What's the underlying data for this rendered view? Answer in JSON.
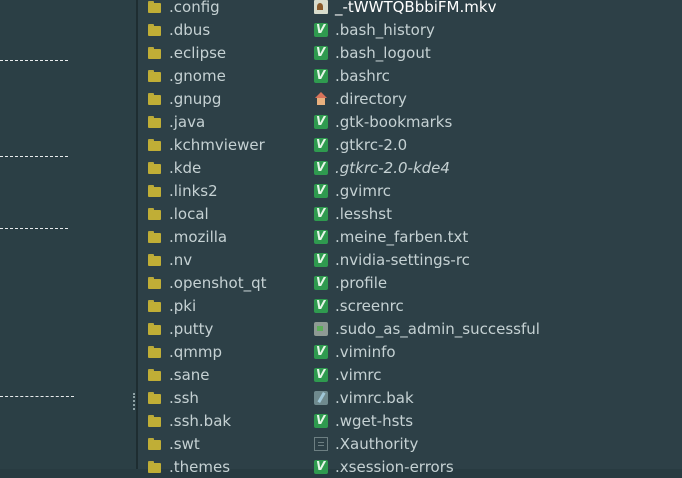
{
  "folders": [
    ".config",
    ".dbus",
    ".eclipse",
    ".gnome",
    ".gnupg",
    ".java",
    ".kchmviewer",
    ".kde",
    ".links2",
    ".local",
    ".mozilla",
    ".nv",
    ".openshot_qt",
    ".pki",
    ".putty",
    ".qmmp",
    ".sane",
    ".ssh",
    ".ssh.bak",
    ".swt",
    ".themes"
  ],
  "files": [
    {
      "name": "_-tWWTQBbbiFM.mkv",
      "icon": "video-icon"
    },
    {
      "name": ".bash_history",
      "icon": "vim-icon"
    },
    {
      "name": ".bash_logout",
      "icon": "vim-icon"
    },
    {
      "name": ".bashrc",
      "icon": "vim-icon"
    },
    {
      "name": ".directory",
      "icon": "home-icon"
    },
    {
      "name": ".gtk-bookmarks",
      "icon": "vim-icon"
    },
    {
      "name": ".gtkrc-2.0",
      "icon": "vim-icon"
    },
    {
      "name": ".gtkrc-2.0-kde4",
      "icon": "vim-icon",
      "italic": true
    },
    {
      "name": ".gvimrc",
      "icon": "vim-icon"
    },
    {
      "name": ".lesshst",
      "icon": "vim-icon"
    },
    {
      "name": ".meine_farben.txt",
      "icon": "vim-icon"
    },
    {
      "name": ".nvidia-settings-rc",
      "icon": "vim-icon"
    },
    {
      "name": ".profile",
      "icon": "vim-icon"
    },
    {
      "name": ".screenrc",
      "icon": "vim-icon"
    },
    {
      "name": ".sudo_as_admin_successful",
      "icon": "script-icon"
    },
    {
      "name": ".viminfo",
      "icon": "vim-icon"
    },
    {
      "name": ".vimrc",
      "icon": "vim-icon"
    },
    {
      "name": ".vimrc.bak",
      "icon": "edit-icon"
    },
    {
      "name": ".wget-hsts",
      "icon": "vim-icon"
    },
    {
      "name": ".Xauthority",
      "icon": "key-icon"
    },
    {
      "name": ".xsession-errors",
      "icon": "vim-icon"
    }
  ]
}
